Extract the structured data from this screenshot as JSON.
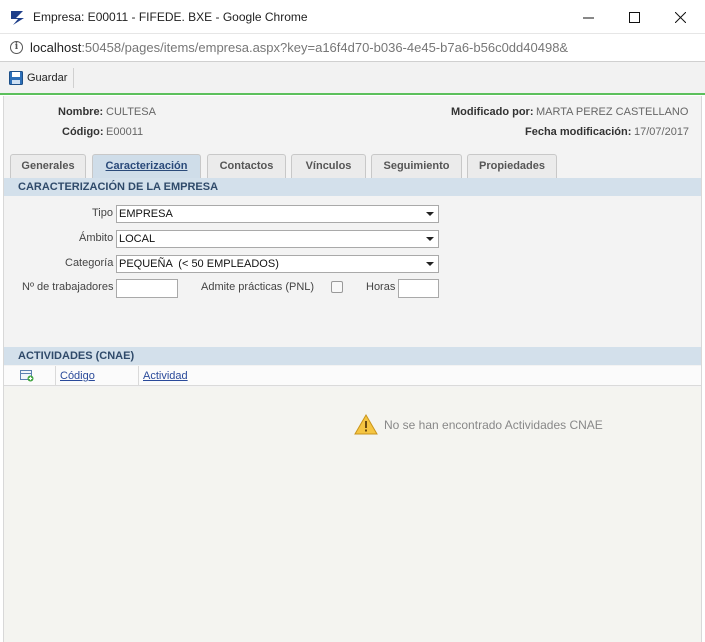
{
  "window": {
    "title": "Empresa: E00011 - FIFEDE. BXE - Google Chrome",
    "url_host": "localhost",
    "url_rest": ":50458/pages/items/empresa.aspx?key=a16f4d70-b036-4e45-b7a6-b56c0dd40498&"
  },
  "toolbar": {
    "save_label": "Guardar"
  },
  "header": {
    "nombre_label": "Nombre:",
    "nombre_value": "CULTESA",
    "codigo_label": "Código:",
    "codigo_value": "E00011",
    "modificado_label": "Modificado por:",
    "modificado_value": "MARTA PEREZ CASTELLANO",
    "fecha_label": "Fecha modificación:",
    "fecha_value": "17/07/2017"
  },
  "tabs": [
    {
      "label": "Generales",
      "active": false
    },
    {
      "label": "Caracterización",
      "active": true
    },
    {
      "label": "Contactos",
      "active": false
    },
    {
      "label": "Vínculos",
      "active": false
    },
    {
      "label": "Seguimiento",
      "active": false
    },
    {
      "label": "Propiedades",
      "active": false
    }
  ],
  "caracterizacion": {
    "section_title": "CARACTERIZACIÓN DE LA EMPRESA",
    "tipo_label": "Tipo",
    "tipo_value": "EMPRESA",
    "ambito_label": "Ámbito",
    "ambito_value": "LOCAL",
    "categoria_label": "Categoría",
    "categoria_value": "PEQUEÑA  (< 50 EMPLEADOS)",
    "trabajadores_label": "Nº de trabajadores",
    "trabajadores_value": "",
    "practicas_label": "Admite prácticas (PNL)",
    "practicas_checked": false,
    "horas_label": "Horas",
    "horas_value": ""
  },
  "actividades": {
    "section_title": "ACTIVIDADES (CNAE)",
    "columns": [
      "Código",
      "Actividad"
    ],
    "empty_message": "No se han encontrado Actividades CNAE"
  },
  "colors": {
    "accent_green": "#5cc05c",
    "section_blue": "#d3e0eb",
    "link_blue": "#2a4a9a"
  }
}
